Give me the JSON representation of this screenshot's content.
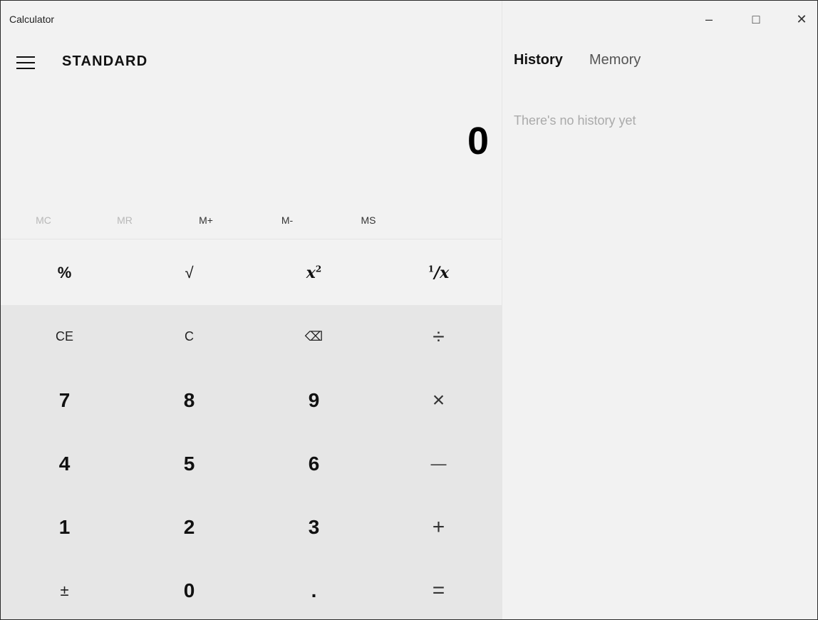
{
  "window": {
    "title": "Calculator",
    "controls": {
      "minimize": "–",
      "maximize": "□",
      "close": "✕"
    }
  },
  "header": {
    "mode": "STANDARD"
  },
  "display": {
    "value": "0"
  },
  "memory": {
    "buttons": [
      {
        "label": "MC",
        "enabled": false
      },
      {
        "label": "MR",
        "enabled": false
      },
      {
        "label": "M+",
        "enabled": true
      },
      {
        "label": "M-",
        "enabled": true
      },
      {
        "label": "MS",
        "enabled": true
      }
    ]
  },
  "keys": {
    "percent": "%",
    "sqrt": "√",
    "square": "x",
    "square_sup": "2",
    "reciprocal_num": "1",
    "reciprocal_den": "/x",
    "ce": "CE",
    "c": "C",
    "backspace": "⌫",
    "divide": "÷",
    "seven": "7",
    "eight": "8",
    "nine": "9",
    "multiply": "×",
    "four": "4",
    "five": "5",
    "six": "6",
    "minus": "—",
    "one": "1",
    "two": "2",
    "three": "3",
    "plus": "+",
    "negate": "±",
    "zero": "0",
    "decimal": ".",
    "equals": "="
  },
  "side": {
    "tabs": [
      {
        "label": "History",
        "active": true
      },
      {
        "label": "Memory",
        "active": false
      }
    ],
    "empty_message": "There's no history yet"
  }
}
